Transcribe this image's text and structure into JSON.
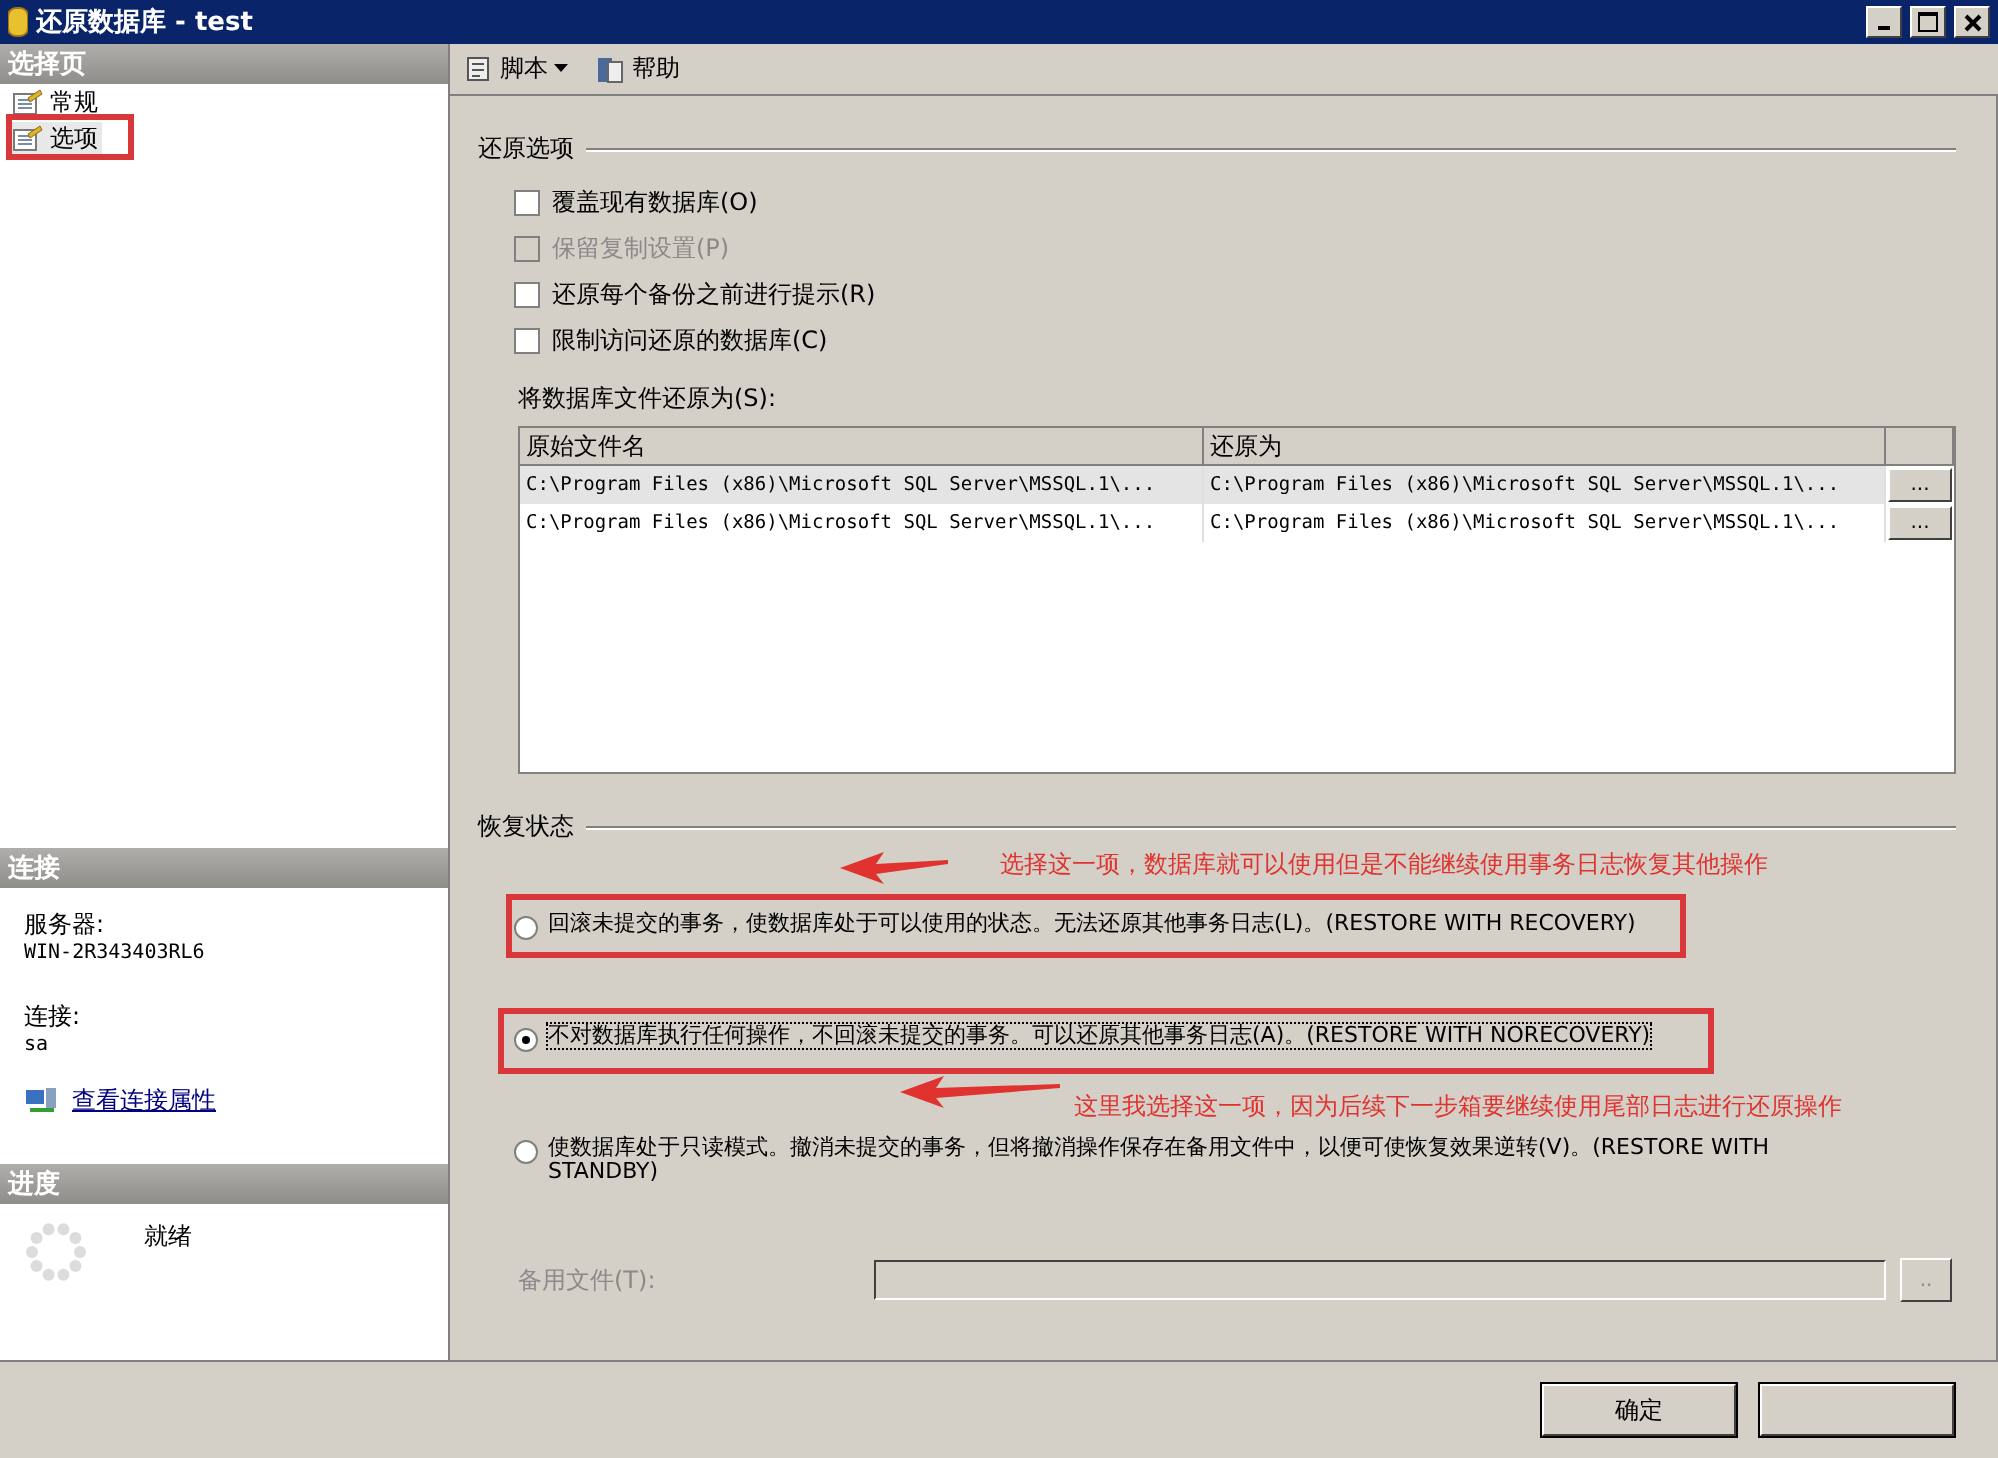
{
  "window": {
    "title": "还原数据库 - test"
  },
  "sidebar": {
    "header": "选择页",
    "items": [
      {
        "label": "常规",
        "selected": false
      },
      {
        "label": "选项",
        "selected": true
      }
    ]
  },
  "connection": {
    "header": "连接",
    "server_label": "服务器:",
    "server": "WIN-2R343403RL6",
    "login_label": "连接:",
    "login": "sa",
    "link": "查看连接属性"
  },
  "progress": {
    "header": "进度",
    "status": "就绪"
  },
  "toolbar": [
    {
      "label": "脚本",
      "kind": "dropdown"
    },
    {
      "label": "帮助",
      "kind": "button"
    }
  ],
  "restore_options": {
    "title": "还原选项",
    "checkboxes": [
      {
        "label": "覆盖现有数据库(O)",
        "checked": false,
        "disabled": false
      },
      {
        "label": "保留复制设置(P)",
        "checked": false,
        "disabled": true
      },
      {
        "label": "还原每个备份之前进行提示(R)",
        "checked": false,
        "disabled": false
      },
      {
        "label": "限制访问还原的数据库(C)",
        "checked": false,
        "disabled": false
      }
    ]
  },
  "files": {
    "label": "将数据库文件还原为(S):",
    "columns": [
      "原始文件名",
      "还原为"
    ],
    "rows": [
      {
        "original": "C:\\Program Files (x86)\\Microsoft SQL Server\\MSSQL.1\\...",
        "restore_as": "C:\\Program Files (x86)\\Microsoft SQL Server\\MSSQL.1\\...",
        "browse": "...",
        "selected": true
      },
      {
        "original": "C:\\Program Files (x86)\\Microsoft SQL Server\\MSSQL.1\\...",
        "restore_as": "C:\\Program Files (x86)\\Microsoft SQL Server\\MSSQL.1\\...",
        "browse": "...",
        "selected": false
      }
    ]
  },
  "recovery": {
    "title": "恢复状态",
    "options": [
      {
        "label": "回滚未提交的事务，使数据库处于可以使用的状态。无法还原其他事务日志(L)。(RESTORE WITH RECOVERY)",
        "selected": false
      },
      {
        "label": "不对数据库执行任何操作，不回滚未提交的事务。可以还原其他事务日志(A)。(RESTORE WITH NORECOVERY)",
        "selected": true
      },
      {
        "label": "使数据库处于只读模式。撤消未提交的事务，但将撤消操作保存在备用文件中，以便可使恢复效果逆转(V)。(RESTORE WITH STANDBY)",
        "selected": false
      }
    ],
    "standby_file": {
      "label": "备用文件(T):",
      "browse": "..",
      "disabled": true
    }
  },
  "buttons": [
    "确定"
  ],
  "annotations": [
    {
      "text": "选择这一项，数据库就可以使用但是不能继续使用事务日志恢复其他操作"
    },
    {
      "text": "这里我选择这一项，因为后续下一步箱要继续使用尾部日志进行还原操作"
    }
  ]
}
